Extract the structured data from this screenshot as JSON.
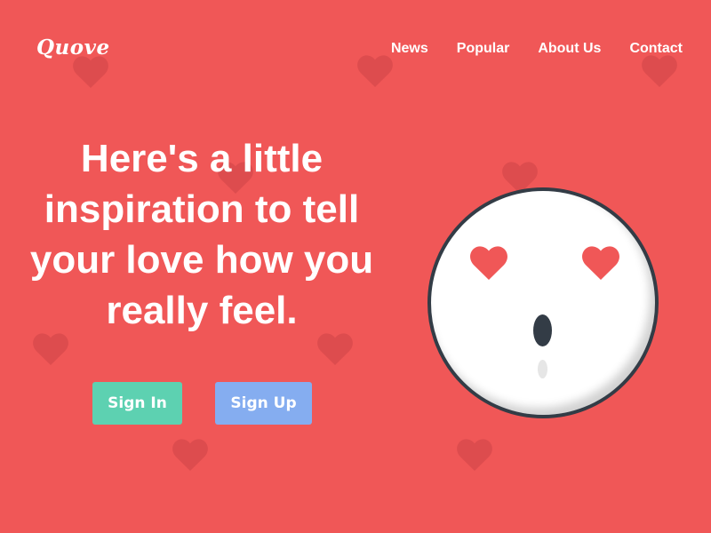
{
  "brand": {
    "logo": "Quove"
  },
  "nav": {
    "items": [
      {
        "label": "News"
      },
      {
        "label": "Popular"
      },
      {
        "label": "About Us"
      },
      {
        "label": "Contact"
      }
    ]
  },
  "hero": {
    "headline_lines": [
      "Here's a little",
      "inspiration to tell",
      "your love how you",
      "really feel."
    ]
  },
  "actions": {
    "sign_in_label": "Sign In",
    "sign_up_label": "Sign Up"
  },
  "colors": {
    "background": "#f05757",
    "background_heart": "#d84a4c",
    "sign_in": "#5dd1b1",
    "sign_up": "#85adf0",
    "face_outline": "#333c46",
    "heart_eyes": "#f05757"
  },
  "icons": {
    "background": "heart-icon",
    "face": "heart-eyes-kiss-face-icon"
  }
}
